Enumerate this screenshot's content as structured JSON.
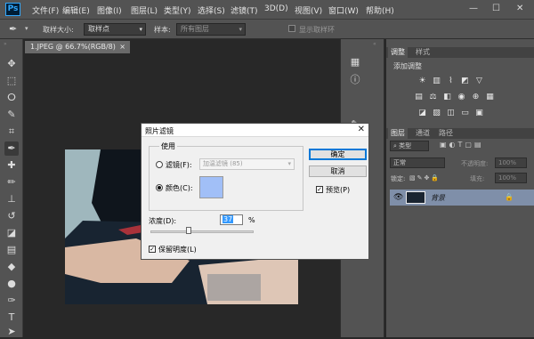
{
  "app": {
    "logo": "Ps"
  },
  "menubar": {
    "items": [
      "文件(F)",
      "编辑(E)",
      "图像(I)",
      "图层(L)",
      "类型(Y)",
      "选择(S)",
      "滤镜(T)",
      "3D(D)",
      "视图(V)",
      "窗口(W)",
      "帮助(H)"
    ],
    "window_controls": [
      "—",
      "☐",
      "✕"
    ]
  },
  "optionsbar": {
    "tool_icon": "eyedropper-icon",
    "sample_size_label": "取样大小:",
    "sample_size_value": "取样点",
    "sample_label": "样本:",
    "sample_value": "所有图层",
    "show_ring_label": "显示取样环"
  },
  "document": {
    "tab_title": "1.JPEG @ 66.7%(RGB/8)",
    "tab_close": "×"
  },
  "tools": [
    "move-icon",
    "marquee-icon",
    "lasso-icon",
    "quick-select-icon",
    "crop-icon",
    "eyedropper-icon",
    "healing-icon",
    "brush-icon",
    "stamp-icon",
    "history-brush-icon",
    "eraser-icon",
    "gradient-icon",
    "blur-icon",
    "dodge-icon",
    "pen-icon",
    "type-icon",
    "path-select-icon",
    "shape-icon",
    "hand-icon"
  ],
  "panels": {
    "adjustments_tabs": [
      "调整",
      "样式"
    ],
    "add_adjustment": "添加调整",
    "layers_tabs": [
      "图层",
      "通道",
      "路径"
    ],
    "kind_value": "类型",
    "blend_mode": "正常",
    "opacity_label": "不透明度:",
    "opacity_value": "100%",
    "lock_label": "锁定:",
    "fill_label": "填充:",
    "fill_value": "100%",
    "layer_name": "背景"
  },
  "dialog": {
    "title": "照片滤镜",
    "close": "✕",
    "group_label": "使用",
    "filter_radio_label": "滤镜(F):",
    "filter_value": "加温滤镜 (85)",
    "color_radio_label": "颜色(C):",
    "selected_option": "color",
    "swatch_color": "#a1bff7",
    "ok_label": "确定",
    "cancel_label": "取消",
    "preview_label": "预览(P)",
    "preview_checked": true,
    "density_label": "浓度(D):",
    "density_value": "37",
    "density_unit": "%",
    "density_fraction": 0.37,
    "preserve_label": "保留明度(L)",
    "preserve_checked": true
  }
}
